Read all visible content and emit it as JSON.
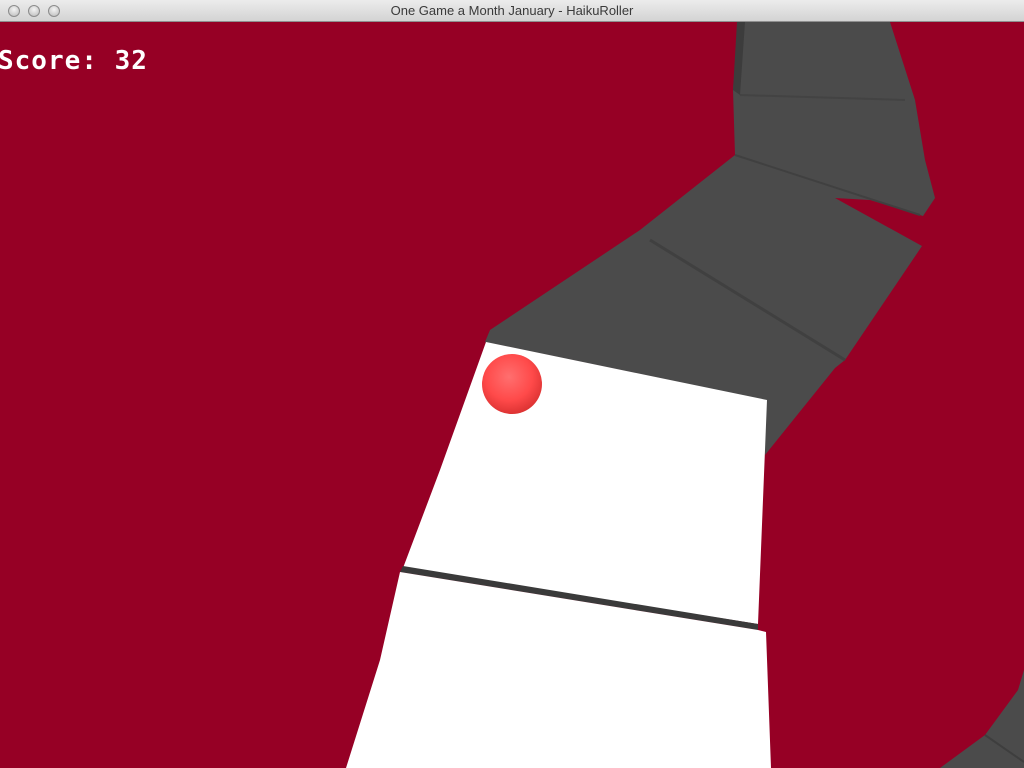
{
  "window": {
    "title": "One Game a Month January - HaikuRoller"
  },
  "hud": {
    "score_label": "Score:",
    "score_value": "32"
  },
  "colors": {
    "background": "#960025",
    "track_active": "#ffffff",
    "track_distant": "#4b4b4b",
    "track_edge": "#3a3a3a",
    "ball": "#ff4a4a"
  },
  "scene": {
    "objects": [
      "player-ball",
      "track-segment-near",
      "track-segment-current",
      "track-segment-distant"
    ]
  }
}
